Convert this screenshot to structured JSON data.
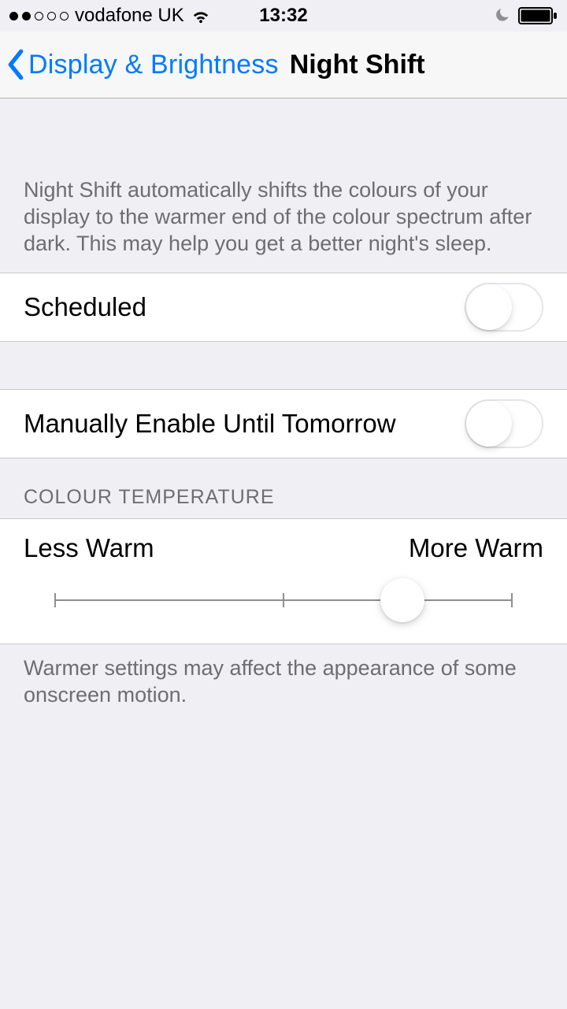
{
  "status_bar": {
    "carrier": "vodafone UK",
    "time": "13:32",
    "signal_filled": 2,
    "signal_total": 5
  },
  "nav": {
    "back_label": "Display & Brightness",
    "title": "Night Shift"
  },
  "sections": {
    "intro": "Night Shift automatically shifts the colours of your display to the warmer end of the colour spectrum after dark. This may help you get a better night's sleep.",
    "scheduled_label": "Scheduled",
    "manual_label": "Manually Enable Until Tomorrow",
    "colour_temp_header": "COLOUR TEMPERATURE",
    "less_warm": "Less Warm",
    "more_warm": "More Warm",
    "slider_footer": "Warmer settings may affect the appearance of some onscreen motion."
  },
  "toggles": {
    "scheduled": false,
    "manual": false
  },
  "slider": {
    "position_percent": 76
  }
}
